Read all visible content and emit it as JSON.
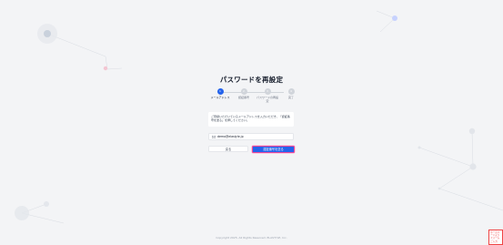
{
  "page": {
    "title": "パスワードを再設定",
    "footer": "Copyright 2025. All Rights Reserved. ELASTYLE, Inc."
  },
  "stepper": {
    "steps": [
      {
        "number": "1",
        "label": "メールアドレス",
        "active": true
      },
      {
        "number": "2",
        "label": "認証番号",
        "active": false
      },
      {
        "number": "3",
        "label": "パスワードの再設定",
        "active": false
      },
      {
        "number": "4",
        "label": "完了",
        "active": false
      }
    ]
  },
  "info": {
    "text": "ご登録いただいているメールアドレスを入力いただき、「認証番号を送る」を押してください。"
  },
  "form": {
    "email_value": "demo@elastyle.jp",
    "email_icon": "mail-icon"
  },
  "buttons": {
    "back_label": "戻る",
    "send_label": "認証番号を送る"
  },
  "corner_note": {
    "text": "ホームページより フォーム ご入力"
  },
  "colors": {
    "background": "#f3f4f6",
    "primary": "#2563eb",
    "highlight": "#ec4899",
    "inactive": "#d1d5db"
  }
}
